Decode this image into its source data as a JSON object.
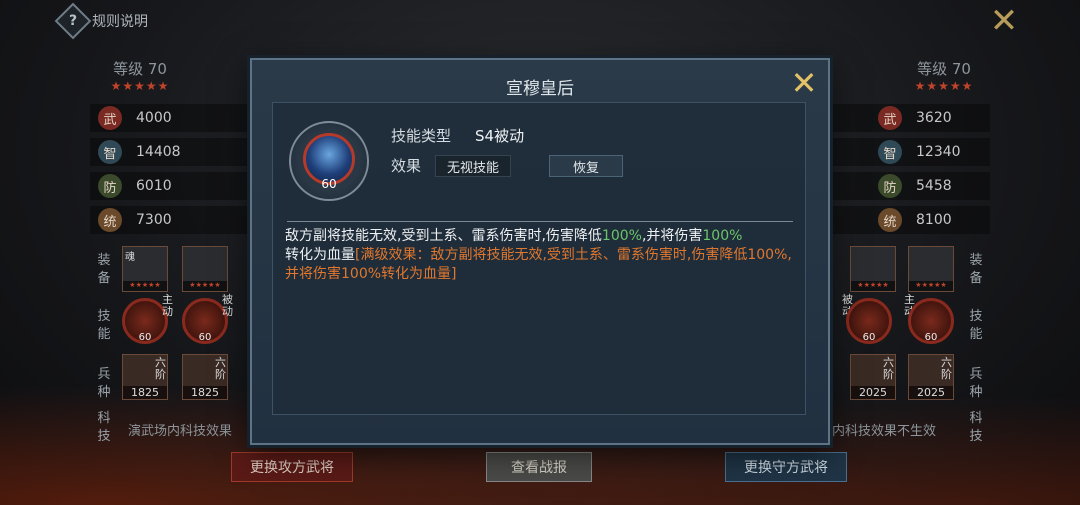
{
  "top": {
    "help_glyph": "?",
    "help_text": "规则说明",
    "close_glyph": "✕"
  },
  "left": {
    "level": "等级 70",
    "stars": "★★★★★",
    "stats": [
      {
        "badge": "武",
        "value": "4000",
        "color": "#7a2a22"
      },
      {
        "badge": "智",
        "value": "14408",
        "color": "#2f4a56"
      },
      {
        "badge": "防",
        "value": "6010",
        "color": "#3a4a2a"
      },
      {
        "badge": "统",
        "value": "7300",
        "color": "#6a4a2a"
      }
    ],
    "equip_label": "装备",
    "skill_label": "技能",
    "troop_label": "兵种",
    "tech_label": "科技",
    "skill_tags": [
      "主动",
      "被动"
    ],
    "skill_levels": [
      "60",
      "60"
    ],
    "troop_tags": [
      "六阶",
      "六阶"
    ],
    "troop_counts": [
      "1825",
      "1825"
    ],
    "equip_marks": [
      "魂",
      ""
    ],
    "footnote": "演武场内科技效果"
  },
  "right": {
    "level": "等级 70",
    "stars": "★★★★★",
    "stats": [
      {
        "badge": "武",
        "value": "3620",
        "color": "#7a2a22"
      },
      {
        "badge": "智",
        "value": "12340",
        "color": "#2f4a56"
      },
      {
        "badge": "防",
        "value": "5458",
        "color": "#3a4a2a"
      },
      {
        "badge": "统",
        "value": "8100",
        "color": "#6a4a2a"
      }
    ],
    "equip_label": "装备",
    "skill_label": "技能",
    "troop_label": "兵种",
    "tech_label": "科技",
    "skill_tags": [
      "被动",
      "主动"
    ],
    "skill_levels": [
      "60",
      "60"
    ],
    "troop_tags": [
      "六阶",
      "六阶"
    ],
    "troop_counts": [
      "2025",
      "2025"
    ],
    "footnote": "内科技效果不生效"
  },
  "buttons": {
    "attack": "更换攻方武将",
    "report": "查看战报",
    "defend": "更换守方武将"
  },
  "modal": {
    "title": "宣穆皇后",
    "close_glyph": "✕",
    "portrait_level": "60",
    "skill_type_label": "技能类型",
    "skill_type_value": "S4被动",
    "effect_label": "效果",
    "effect_chip": "无视技能",
    "restore_chip": "恢复",
    "desc": {
      "p1": "敌方副将技能无效,受到土系、雷系伤害时,伤害降低",
      "p1_pct": "100%",
      "p2": ",并将伤害",
      "p2_pct": "100%",
      "p3": "转化为血量",
      "full": "[满级效果：敌方副将技能无效,受到土系、雷系伤害时,伤害降低100%,并将伤害100%转化为血量]"
    }
  }
}
